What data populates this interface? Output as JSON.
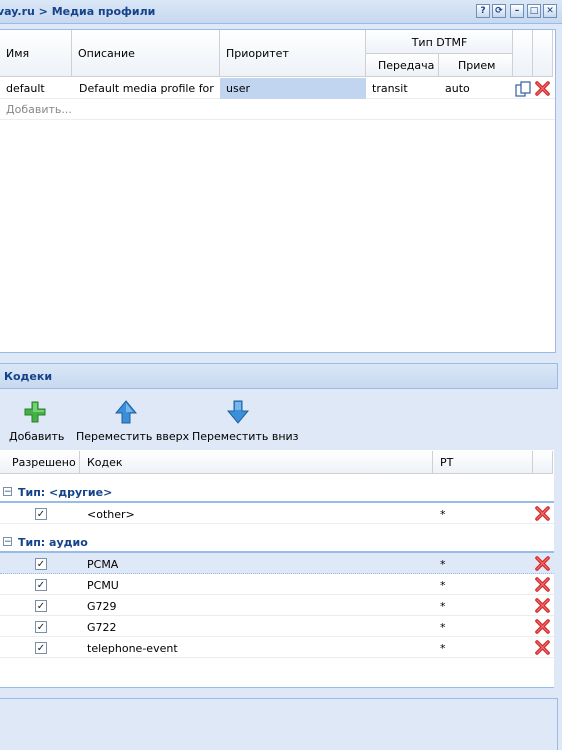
{
  "top_panel": {
    "title": "vay.ru > Медиа профили",
    "tools": [
      "?",
      "⟳",
      "–",
      "□",
      "✕"
    ],
    "columns": {
      "name": "Имя",
      "description": "Описание",
      "priority": "Приоритет",
      "dtmf_group": "Тип DTMF",
      "dtmf_send": "Передача",
      "dtmf_receive": "Прием"
    },
    "rows": [
      {
        "name": "default",
        "description": "Default media profile for ...",
        "priority": "user",
        "send": "transit",
        "receive": "auto"
      }
    ],
    "add_placeholder": "Добавить..."
  },
  "codecs_panel": {
    "title": "Кодеки",
    "toolbar": {
      "add": "Добавить",
      "move_up": "Переместить вверх",
      "move_down": "Переместить вниз"
    },
    "columns": {
      "allowed": "Разрешено",
      "codec": "Кодек",
      "pt": "PT"
    },
    "groups": [
      {
        "label": "Тип: <другие>",
        "rows": [
          {
            "codec": "<other>",
            "pt": "*",
            "allowed": true
          }
        ]
      },
      {
        "label": "Тип: аудио",
        "rows": [
          {
            "codec": "PCMA",
            "pt": "*",
            "allowed": true
          },
          {
            "codec": "PCMU",
            "pt": "*",
            "allowed": true
          },
          {
            "codec": "G729",
            "pt": "*",
            "allowed": true
          },
          {
            "codec": "G722",
            "pt": "*",
            "allowed": true
          },
          {
            "codec": "telephone-event",
            "pt": "*",
            "allowed": true
          }
        ]
      }
    ]
  },
  "colors": {
    "panel_bg": "#dfe8f6",
    "header_text": "#15428b",
    "border": "#99bbe8",
    "selected_cell": "#c1d5f0",
    "add_green": "#3aa53a",
    "arrow_blue": "#3a8fd8",
    "delete_red": "#d42a2a"
  }
}
